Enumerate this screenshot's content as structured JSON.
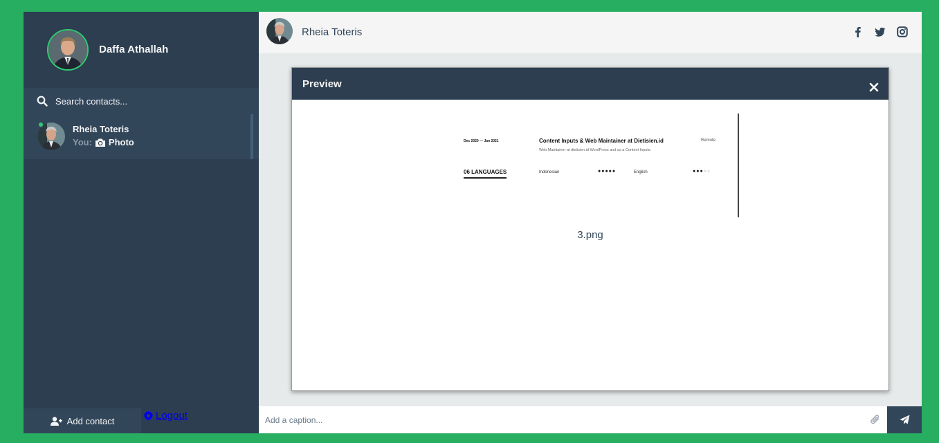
{
  "sidebar": {
    "profile": {
      "name": "Daffa Athallah"
    },
    "search": {
      "placeholder": "Search contacts..."
    },
    "contacts": [
      {
        "name": "Rheia Toteris",
        "preview_prefix": "You:",
        "preview_text": "Photo",
        "status": "online"
      }
    ],
    "bottom": {
      "add_contact_label": "Add contact",
      "logout_label": "Logout"
    }
  },
  "content": {
    "contact_profile": {
      "name": "Rheia Toteris",
      "social_icons": [
        "facebook-icon",
        "twitter-icon",
        "instagram-icon"
      ]
    },
    "preview_modal": {
      "title": "Preview",
      "close_icon": "close-icon",
      "image": {
        "date_range": "Dec 2020 — Jan 2021",
        "job_title": "Content Inputs & Web Maintainer at Dietisien.id",
        "location": "Remote",
        "description": "Web Maintainer at dietisien.id WordPress and as a Content Inputs.",
        "section_heading": "06  LANGUAGES",
        "language_1": "Indonesian",
        "language_1_dots": "●●●●●",
        "language_2": "English",
        "language_2_dots": "●●●",
        "language_2_dots_empty": "●●"
      },
      "file_name": "3.png"
    },
    "message_input": {
      "placeholder": "Add a caption...",
      "attach_icon": "paperclip-icon",
      "send_icon": "paper-plane-icon"
    }
  },
  "colors": {
    "background": "#27ae60",
    "sidebar": "#2c3e50",
    "sidebar_active": "#32465a",
    "online": "#2ecc71",
    "content_bg": "#e6eaea"
  }
}
